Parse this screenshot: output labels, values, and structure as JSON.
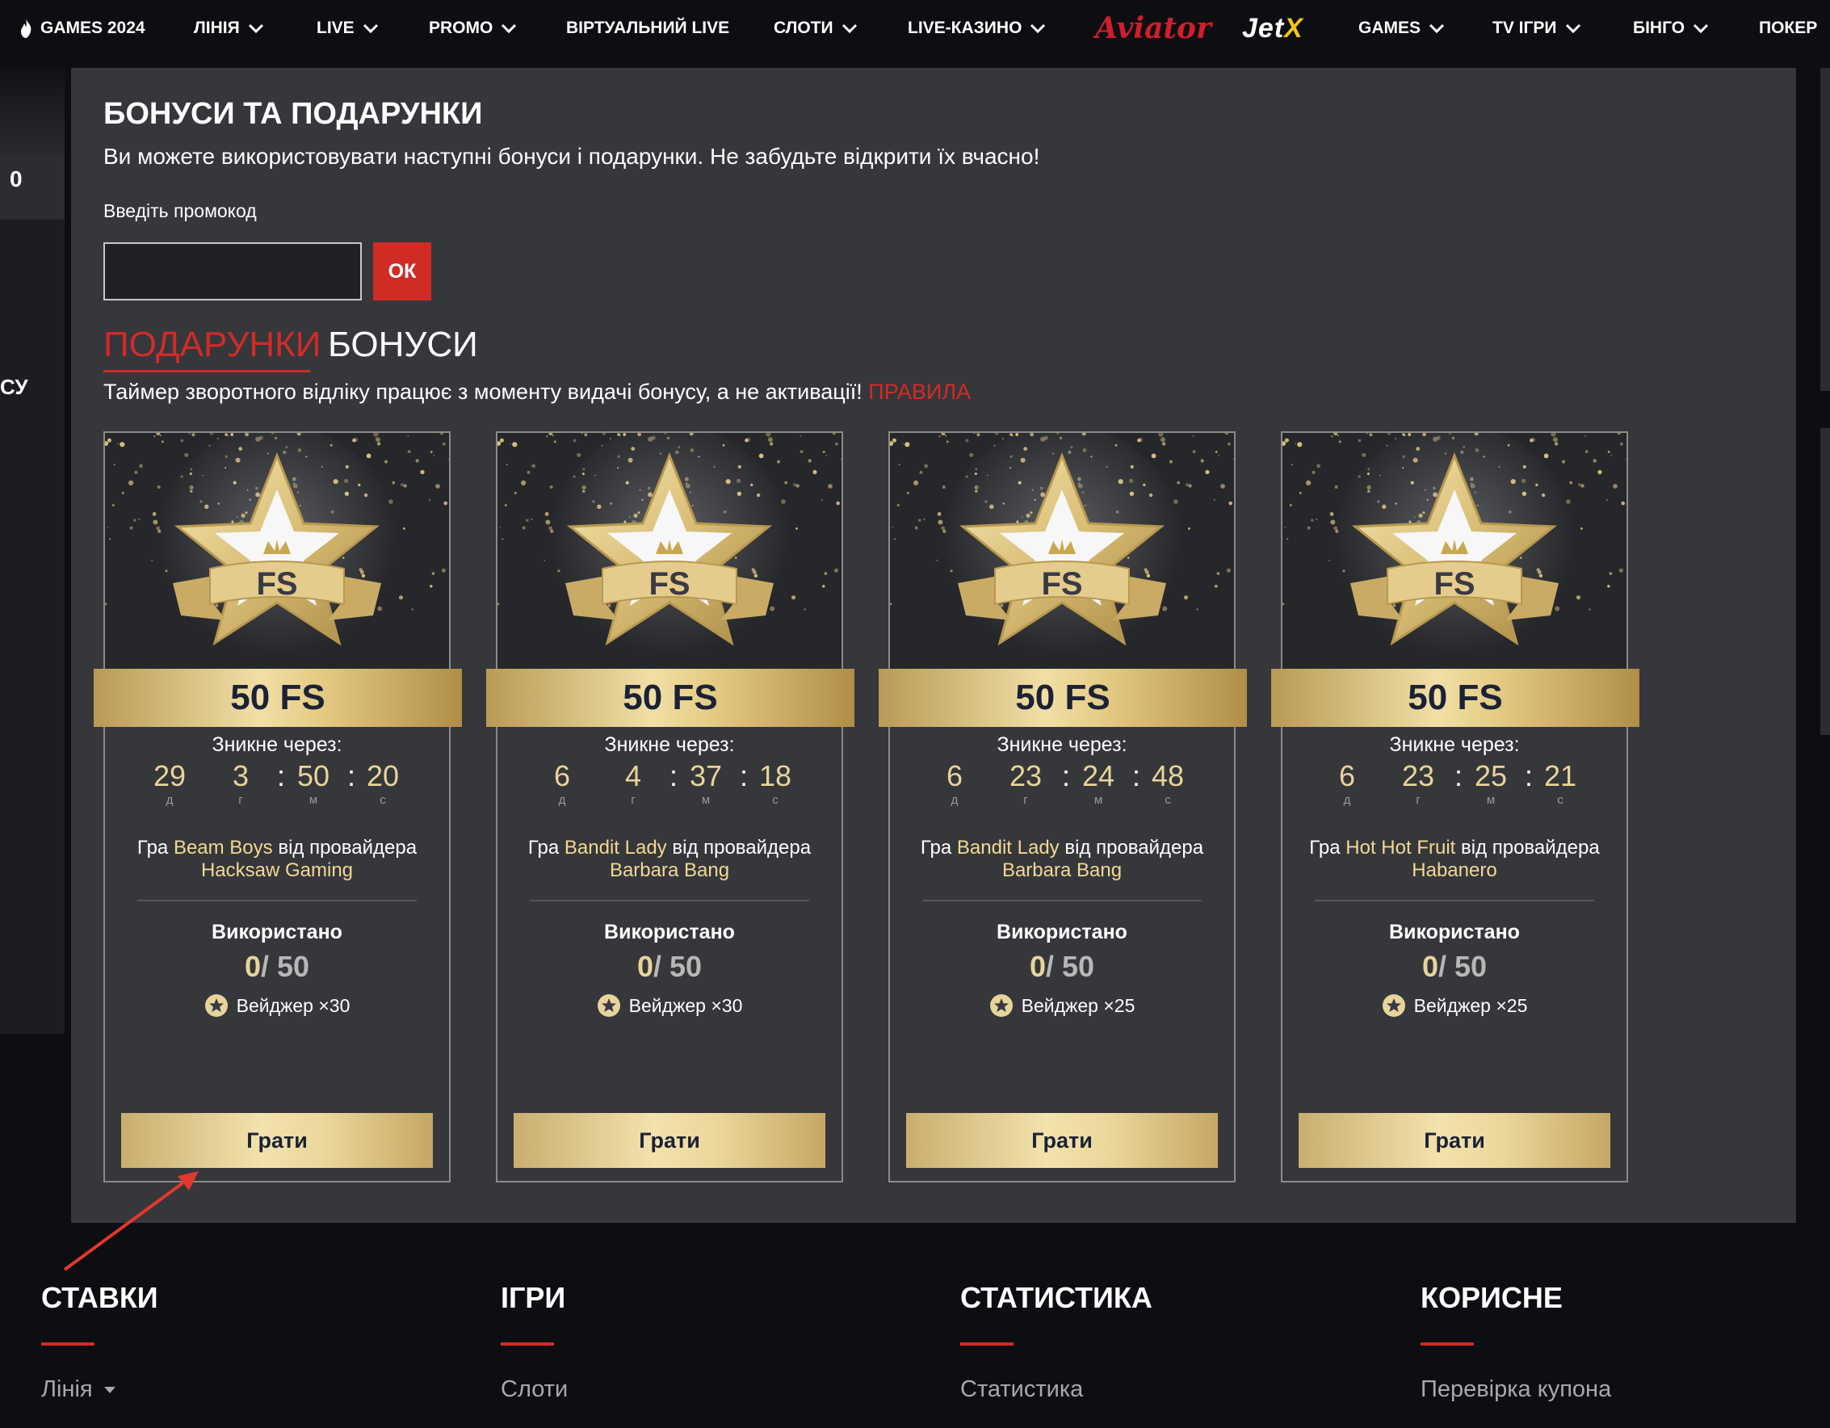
{
  "nav": {
    "items": [
      {
        "label": "GAMES 2024",
        "dropdown": false
      },
      {
        "label": "ЛІНІЯ",
        "dropdown": true
      },
      {
        "label": "LIVE",
        "dropdown": true
      },
      {
        "label": "PROMO",
        "dropdown": true
      },
      {
        "label": "ВІРТУАЛЬНИЙ LIVE",
        "dropdown": false
      },
      {
        "label": "СЛОТИ",
        "dropdown": true
      },
      {
        "label": "LIVE-КАЗИНО",
        "dropdown": true
      },
      {
        "label": "GAMES",
        "dropdown": true
      },
      {
        "label": "TV ІГРИ",
        "dropdown": true
      },
      {
        "label": "БІНГО",
        "dropdown": true
      },
      {
        "label": "ПОКЕР",
        "dropdown": false
      }
    ],
    "logo_aviator": "Aviator",
    "logo_jetx_a": "Jet",
    "logo_jetx_b": "X"
  },
  "sidebar": {
    "counter": "0",
    "partial_text": "СУ"
  },
  "panel": {
    "title": "БОНУСИ ТА ПОДАРУНКИ",
    "subtitle": "Ви можете використовувати наступні бонуси і подарунки. Не забудьте відкрити їх вчасно!",
    "promo_label": "Введіть промокод",
    "promo_value": "",
    "promo_placeholder": "",
    "ok_label": "ОК",
    "tab_gifts": "ПОДАРУНКИ",
    "tab_bonuses": "БОНУСИ",
    "timer_note": "Таймер зворотного відліку працює з моменту видачі бонусу, а не активації!",
    "rules_link": "ПРАВИЛА"
  },
  "cards": [
    {
      "art_label": "FS",
      "title": "50 FS",
      "expire_label": "Зникне через:",
      "days": "29",
      "hours": "3",
      "minutes": "50",
      "seconds": "20",
      "unit_d": "д",
      "unit_h": "г",
      "unit_m": "м",
      "unit_s": "с",
      "game_prefix": "Гра",
      "game": "Beam Boys",
      "provider_prefix": "від провайдера",
      "provider": "Hacksaw Gaming",
      "used_label": "Використано",
      "used": "0",
      "used_total": "/ 50",
      "wager": "Вейджер ×30",
      "play": "Грати"
    },
    {
      "art_label": "FS",
      "title": "50 FS",
      "expire_label": "Зникне через:",
      "days": "6",
      "hours": "4",
      "minutes": "37",
      "seconds": "18",
      "unit_d": "д",
      "unit_h": "г",
      "unit_m": "м",
      "unit_s": "с",
      "game_prefix": "Гра",
      "game": "Bandit Lady",
      "provider_prefix": "від провайдера",
      "provider": "Barbara Bang",
      "used_label": "Використано",
      "used": "0",
      "used_total": "/ 50",
      "wager": "Вейджер ×30",
      "play": "Грати"
    },
    {
      "art_label": "FS",
      "title": "50 FS",
      "expire_label": "Зникне через:",
      "days": "6",
      "hours": "23",
      "minutes": "24",
      "seconds": "48",
      "unit_d": "д",
      "unit_h": "г",
      "unit_m": "м",
      "unit_s": "с",
      "game_prefix": "Гра",
      "game": "Bandit Lady",
      "provider_prefix": "від провайдера",
      "provider": "Barbara Bang",
      "used_label": "Використано",
      "used": "0",
      "used_total": "/ 50",
      "wager": "Вейджер ×25",
      "play": "Грати"
    },
    {
      "art_label": "FS",
      "title": "50 FS",
      "expire_label": "Зникне через:",
      "days": "6",
      "hours": "23",
      "minutes": "25",
      "seconds": "21",
      "unit_d": "д",
      "unit_h": "г",
      "unit_m": "м",
      "unit_s": "с",
      "game_prefix": "Гра",
      "game": "Hot Hot Fruit",
      "provider_prefix": "від провайдера",
      "provider": "Habanero",
      "used_label": "Використано",
      "used": "0",
      "used_total": "/ 50",
      "wager": "Вейджер ×25",
      "play": "Грати"
    }
  ],
  "footer": {
    "columns": [
      {
        "heading": "СТАВКИ",
        "link": "Лінія"
      },
      {
        "heading": "ІГРИ",
        "link": "Слоти"
      },
      {
        "heading": "СТАТИСТИКА",
        "link": "Статистика"
      },
      {
        "heading": "КОРИСНЕ",
        "link": "Перевірка купона"
      }
    ]
  },
  "colors": {
    "accent_red": "#d12b26",
    "gold": "#e8d49a",
    "panel_bg": "#36373b",
    "page_bg": "#0d0e12",
    "annotation_arrow": "#e2382c"
  },
  "icons": [
    "chevron-down-icon",
    "flame-logo-icon",
    "star-badge-icon",
    "star-medal-art"
  ]
}
